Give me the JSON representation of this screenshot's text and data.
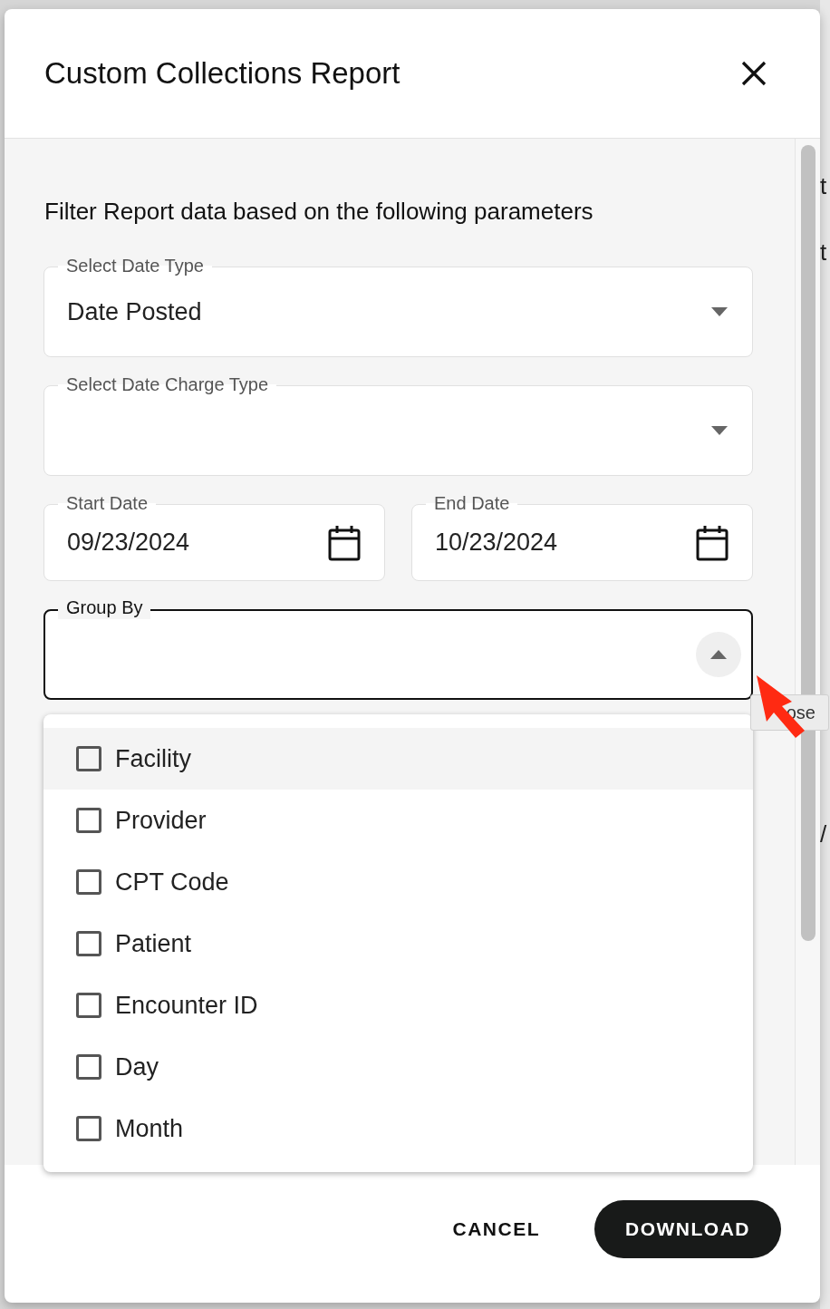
{
  "background_fragments": [
    {
      "text": "t"
    },
    {
      "text": "t"
    },
    {
      "text": "/"
    }
  ],
  "dialog": {
    "title": "Custom Collections Report",
    "intro": "Filter Report data based on the following parameters",
    "date_type": {
      "label": "Select Date Type",
      "value": "Date Posted",
      "focused": false,
      "open": false
    },
    "charge_type": {
      "label": "Select Date Charge Type",
      "focused": false,
      "open": false
    },
    "dates": [
      {
        "label": "Start Date",
        "value": "09/23/2024"
      },
      {
        "label": "End Date",
        "value": "10/23/2024"
      }
    ],
    "group_by": {
      "label": "Group By",
      "focused": true,
      "open": true,
      "tooltip": "ose",
      "options": [
        {
          "label": "Facility",
          "checked": false,
          "highlighted": true
        },
        {
          "label": "Provider",
          "checked": false,
          "highlighted": false
        },
        {
          "label": "CPT Code",
          "checked": false,
          "highlighted": false
        },
        {
          "label": "Patient",
          "checked": false,
          "highlighted": false
        },
        {
          "label": "Encounter ID",
          "checked": false,
          "highlighted": false
        },
        {
          "label": "Day",
          "checked": false,
          "highlighted": false
        },
        {
          "label": "Month",
          "checked": false,
          "highlighted": false
        }
      ]
    },
    "buttons": [
      {
        "label": "CANCEL",
        "kind": "text"
      },
      {
        "label": "DOWNLOAD",
        "kind": "filled"
      }
    ]
  }
}
